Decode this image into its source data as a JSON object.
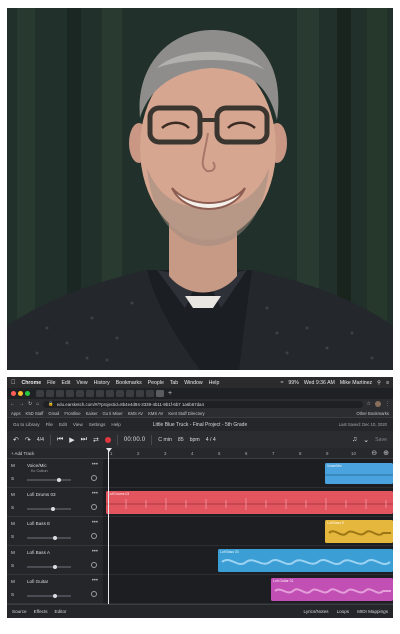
{
  "mac_menubar": {
    "app_name": "Chrome",
    "menus": [
      "File",
      "Edit",
      "View",
      "History",
      "Bookmarks",
      "People",
      "Tab",
      "Window",
      "Help"
    ],
    "battery": "99%",
    "clock": "Wed 9:36 AM",
    "user": "Mike Martinez"
  },
  "browser": {
    "url": "edu.earsketch.com/#/?projectid=8b4e4d94-3339-4b11-9b1f-6b7 1a6b67da4",
    "bookmarks": [
      "Apps",
      "K5D Staff",
      "Gmail",
      "Frontline",
      "Kaiser",
      "Go ti Mixer",
      "KMS AV",
      "KMS AV",
      "Kent Staff Directory"
    ],
    "other_bookmarks": "Other Bookmarks"
  },
  "app": {
    "go_to_library": "Go to Library",
    "menus": [
      "File",
      "Edit",
      "View",
      "Settings",
      "Help"
    ],
    "project_title": "Little Blue Truck - Final Project - 5th Grade",
    "last_saved": "Last Saved: Dec 10, 2020"
  },
  "transport": {
    "bars": "4/4",
    "time": "00:00.0",
    "key": "C min",
    "tempo_value": "85",
    "tempo_unit": "bpm",
    "meter": "4 / 4",
    "save_label": "Save"
  },
  "ruler": {
    "add_track": "+ Add Track",
    "bar_numbers": [
      "1",
      "2",
      "3",
      "4",
      "5",
      "6",
      "7",
      "8",
      "9",
      "10",
      "11"
    ]
  },
  "tracks": [
    {
      "name": "Voice/Mic",
      "sub": "Kc Cutton",
      "clip": "Voice/Mic",
      "color": "#4aa3df"
    },
    {
      "name": "Lofi Drums 03",
      "sub": "",
      "clip": "Lofi Drums 03",
      "color": "#e2555f"
    },
    {
      "name": "Lofi Bass E",
      "sub": "",
      "clip": "Lofi Bass E",
      "color": "#e5b73c"
    },
    {
      "name": "Lofi Bass A",
      "sub": "",
      "clip": "Lofi Bass 03",
      "color": "#3b9fd6"
    },
    {
      "name": "Lofi Guitar",
      "sub": "",
      "clip": "Lofi Guitar 01",
      "color": "#c14fb4"
    }
  ],
  "track_controls": {
    "mute": "M",
    "solo": "S",
    "more": "•••"
  },
  "bottom_bar": {
    "source": "Source",
    "effects": "Effects",
    "editor": "Editor",
    "lyrics": "Lyrics/Notes",
    "loops": "Loops",
    "midi": "MIDI Mappings"
  },
  "colors": {
    "record": "#e0373f",
    "accent_blue": "#4aa3df",
    "drums_red": "#e2555f",
    "bass_yellow": "#e5b73c",
    "guitar_magenta": "#c14fb4"
  }
}
